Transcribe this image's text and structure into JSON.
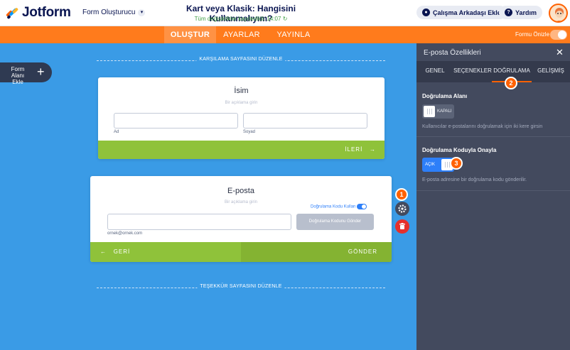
{
  "header": {
    "logo_text": "Jotform",
    "builder_menu": "Form Oluşturucu",
    "doc_title": "Kart veya Klasik: Hangisini Kullanmalıyım?",
    "save_status": "Tüm değişiklikler kaydedildi: 14:07",
    "collaborator_button": "Çalışma Arkadaşı Ekle",
    "help_button": "Yardım"
  },
  "nav": {
    "tabs": [
      "OLUŞTUR",
      "AYARLAR",
      "YAYINLA"
    ],
    "active_tab": "OLUŞTUR",
    "preview_label": "Formu Önizle"
  },
  "canvas": {
    "add_field_label": "Form Alanı Ekle",
    "welcome_divider": "KARŞILAMA SAYFASINI DÜZENLE",
    "thankyou_divider": "TEŞEKKÜR SAYFASINI DÜZENLE",
    "name_card": {
      "title": "İsim",
      "description": "Bir açıklama girin",
      "first_label": "Ad",
      "last_label": "Soyad",
      "next_button": "İLERİ"
    },
    "email_card": {
      "title": "E-posta",
      "description": "Bir açıklama girin",
      "verify_toggle_label": "Doğrulama Kodu Kullan",
      "sublabel": "ornek@ornek.com",
      "send_code_button": "Doğrulama Kodunu Gönder",
      "back_button": "GERİ",
      "submit_button": "GÖNDER"
    },
    "badges": [
      "1",
      "2",
      "3"
    ]
  },
  "panel": {
    "title": "E-posta Özellikleri",
    "tabs": [
      "GENEL",
      "SEÇENEKLER",
      "DOĞRULAMA",
      "GELİŞMİŞ"
    ],
    "active_tab": "DOĞRULAMA",
    "confirm_field": {
      "title": "Doğrulama Alanı",
      "switch_label": "KAPALI",
      "description": "Kullanıcılar e-postalarını doğrulamak için iki kere girsin"
    },
    "verify_code": {
      "title": "Doğrulama Koduyla Onayla",
      "switch_label": "AÇIK",
      "description": "E-posta adresine bir doğrulama kodu gönderilir."
    }
  },
  "colors": {
    "canvas_bg": "#3a9be6",
    "orange": "#ff7b1c",
    "green": "#8fc23a",
    "panel_bg": "#434a5e",
    "badge": "#ff6100",
    "toggle_on": "#2d7ff9"
  },
  "icons": [
    "user-icon",
    "help-icon",
    "close-icon",
    "gear-icon",
    "trash-icon",
    "arrow-right-icon",
    "arrow-left-icon",
    "refresh-icon",
    "plus-icon",
    "chevron-down-icon"
  ]
}
